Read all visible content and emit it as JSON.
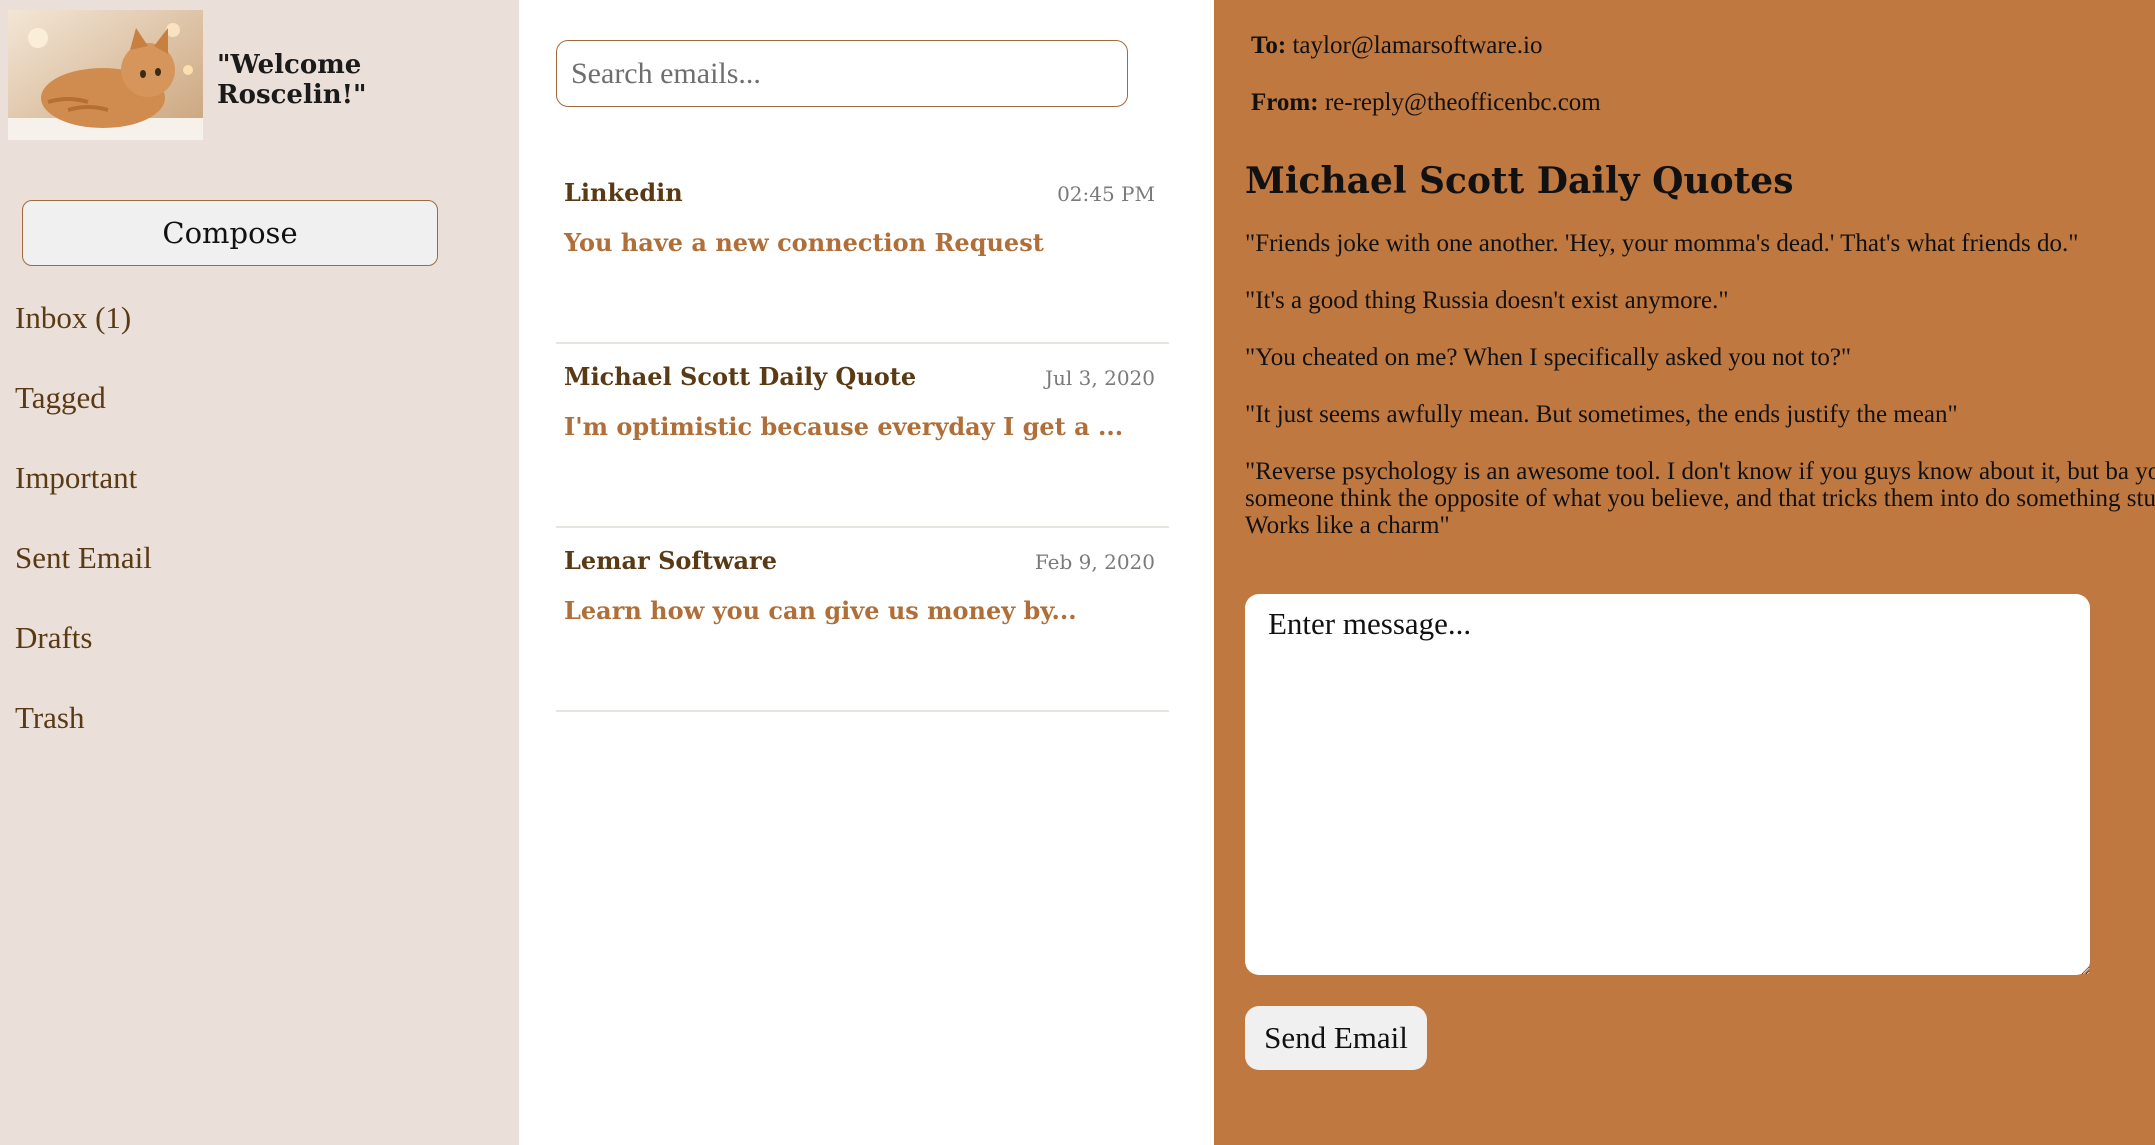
{
  "sidebar": {
    "welcome": "\"Welcome Roscelin!\"",
    "compose_label": "Compose",
    "nav": [
      "Inbox (1)",
      "Tagged",
      "Important",
      "Sent Email",
      "Drafts",
      "Trash"
    ]
  },
  "list": {
    "search_placeholder": "Search emails...",
    "emails": [
      {
        "sender": "Linkedin",
        "date": "02:45 PM",
        "subject": "You have a new connection Request"
      },
      {
        "sender": "Michael Scott Daily Quote",
        "date": "Jul 3, 2020",
        "subject": "I'm optimistic because everyday I get a ..."
      },
      {
        "sender": "Lemar Software",
        "date": "Feb 9, 2020",
        "subject": "Learn how you can give us money by..."
      }
    ]
  },
  "reader": {
    "to_label": "To:",
    "to_value": "taylor@lamarsoftware.io",
    "from_label": "From:",
    "from_value": "re-reply@theofficenbc.com",
    "title": "Michael Scott Daily Quotes",
    "quotes": [
      "\"Friends joke with one another. 'Hey, your momma's dead.' That's what friends do.\"",
      "\"It's a good thing Russia doesn't exist anymore.\"",
      "\"You cheated on me? When I specifically asked you not to?\"",
      "\"It just seems awfully mean. But sometimes, the ends justify the mean\"",
      "\"Reverse psychology is an awesome tool. I don't know if you guys know about it, but ba you make someone think the opposite of what you believe, and that tricks them into do something stupid. Works like a charm\""
    ],
    "message_placeholder": "Enter message...",
    "send_label": "Send Email"
  },
  "colors": {
    "sidebar_bg": "#ebe0d9",
    "accent": "#c07841",
    "sender_text": "#5a3a14",
    "subject_text": "#b06f38"
  }
}
